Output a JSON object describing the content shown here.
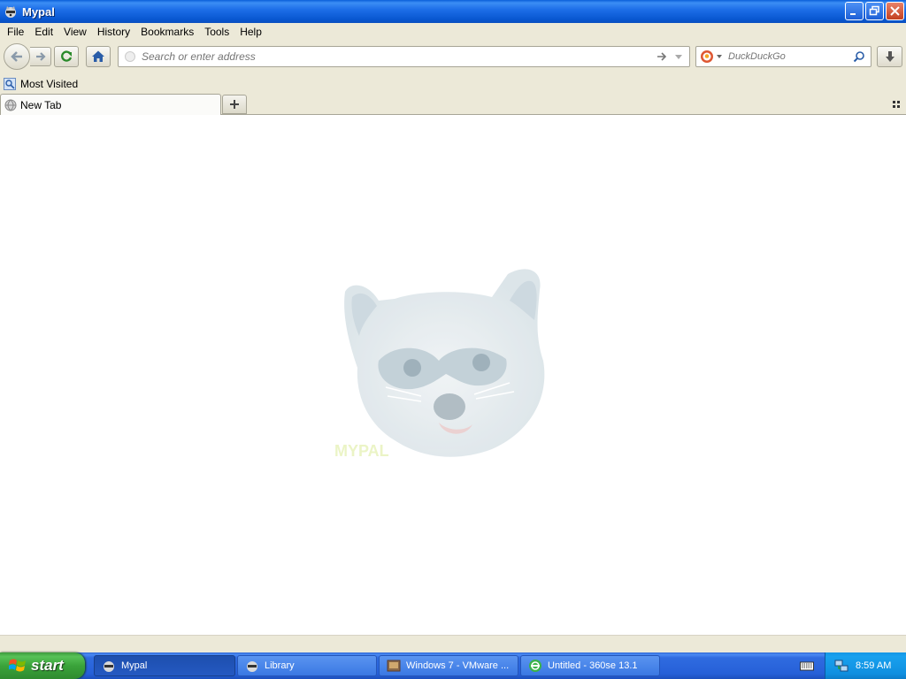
{
  "window": {
    "title": "Mypal"
  },
  "menu": {
    "items": [
      "File",
      "Edit",
      "View",
      "History",
      "Bookmarks",
      "Tools",
      "Help"
    ]
  },
  "navbar": {
    "url_placeholder": "Search or enter address",
    "search_placeholder": "DuckDuckGo"
  },
  "bookmarks": {
    "items": [
      {
        "label": "Most Visited"
      }
    ]
  },
  "tabs": [
    {
      "label": "New Tab"
    }
  ],
  "taskbar": {
    "start_label": "start",
    "tasks": [
      {
        "label": "Mypal",
        "active": true
      },
      {
        "label": "Library",
        "active": false
      },
      {
        "label": "Windows 7 - VMware ...",
        "active": false
      },
      {
        "label": "Untitled - 360se 13.1",
        "active": false
      }
    ],
    "clock": "8:59 AM"
  },
  "colors": {
    "titlebar": "#0856d0",
    "taskbar": "#2660d8",
    "start": "#3aa33a",
    "chrome": "#ece9d8"
  }
}
